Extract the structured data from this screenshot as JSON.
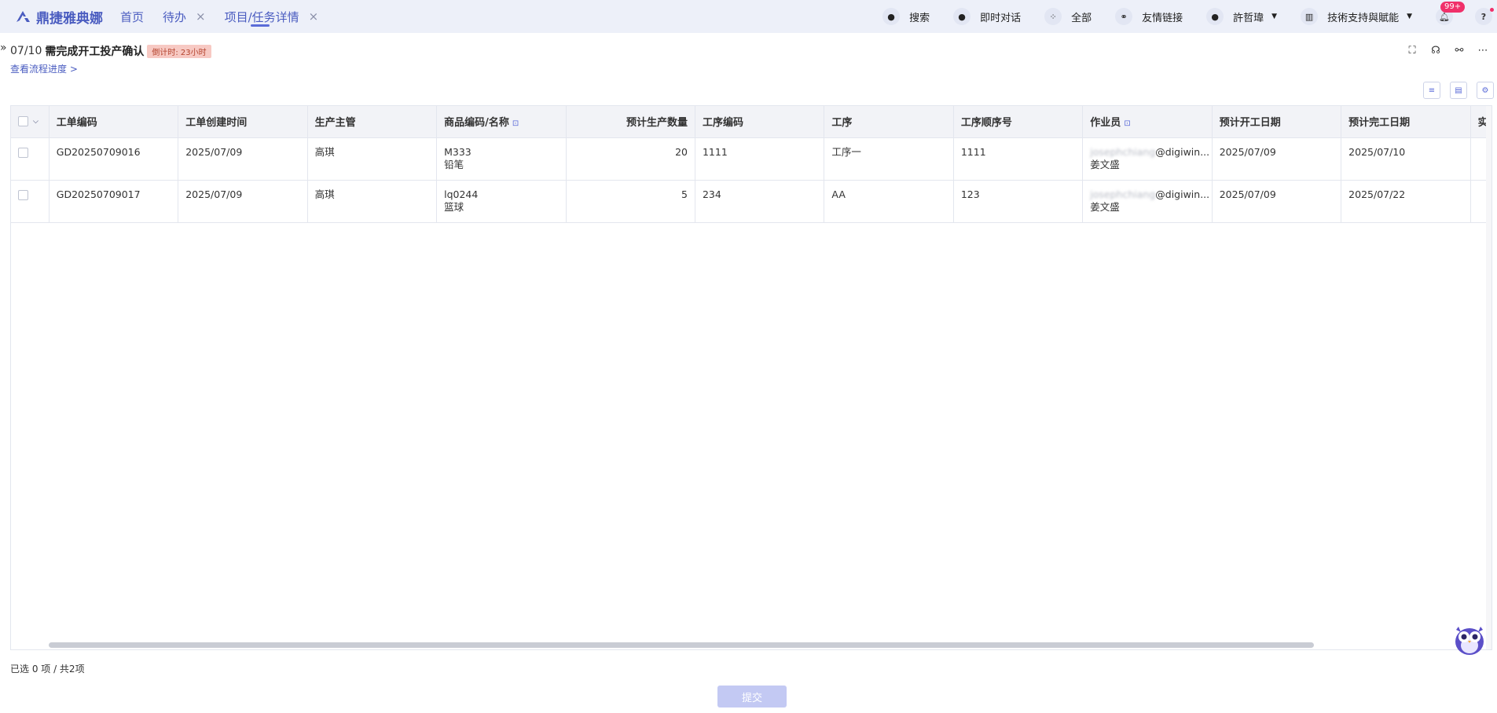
{
  "app": {
    "logo_text": "鼎捷雅典娜"
  },
  "nav": {
    "tabs": [
      {
        "label": "首页",
        "closable": false
      },
      {
        "label": "待办",
        "closable": true
      },
      {
        "label": "项目/任务详情",
        "closable": true,
        "active": true
      }
    ],
    "right": {
      "search": "搜索",
      "chat": "即时对话",
      "all": "全部",
      "links": "友情链接",
      "user": "許哲瑋",
      "org": "技術支持與賦能",
      "notifications": "99+",
      "help": "?"
    }
  },
  "task": {
    "date": "07/10",
    "title": "需完成开工投产确认",
    "countdown": "倒计时: 23小时",
    "progress_link": "查看流程进度 >"
  },
  "table": {
    "columns": [
      "工单编码",
      "工单创建时间",
      "生产主管",
      "商品编码/名称",
      "预计生产数量",
      "工序编码",
      "工序",
      "工序顺序号",
      "作业员",
      "预计开工日期",
      "预计完工日期",
      "实际开工日"
    ],
    "rows": [
      {
        "order_no": "GD20250709016",
        "created": "2025/07/09",
        "supervisor": "高琪",
        "item_code": "M333",
        "item_name": "铅笔",
        "qty": "20",
        "op_code": "1111",
        "op": "工序一",
        "op_seq": "1111",
        "operator_email_hidden": "josephchiang",
        "operator_email_domain": "@digiwin...",
        "operator_name": "姜文盛",
        "plan_start": "2025/07/09",
        "plan_end": "2025/07/10",
        "actual_start": ""
      },
      {
        "order_no": "GD20250709017",
        "created": "2025/07/09",
        "supervisor": "高琪",
        "item_code": "lq0244",
        "item_name": "篮球",
        "qty": "5",
        "op_code": "234",
        "op": "AA",
        "op_seq": "123",
        "operator_email_hidden": "josephchiang",
        "operator_email_domain": "@digiwin...",
        "operator_name": "姜文盛",
        "plan_start": "2025/07/09",
        "plan_end": "2025/07/22",
        "actual_start": ""
      }
    ]
  },
  "footer": {
    "selection": "已选 0 项 / 共2项",
    "submit_label": "提交"
  },
  "colors": {
    "accent": "#4a5cc0",
    "badge": "#f0306a",
    "countdown_bg": "#f7c9c3",
    "submit_disabled": "#c3c9f3"
  }
}
